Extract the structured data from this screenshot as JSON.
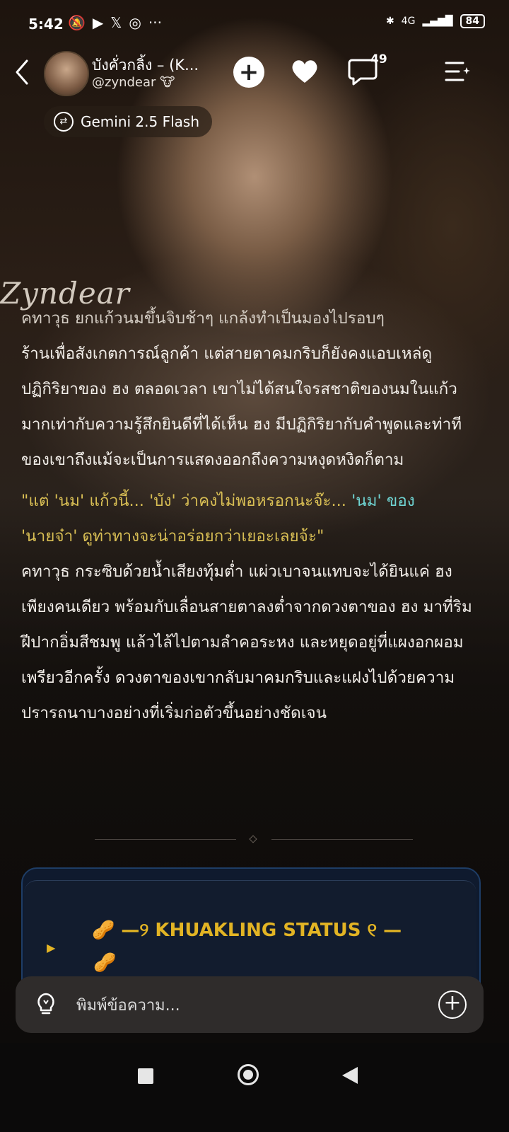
{
  "status_bar": {
    "time": "5:42",
    "icons": [
      "mute-bell-icon",
      "youtube-icon",
      "x-icon",
      "instagram-icon",
      "more-icon"
    ],
    "network": "4G",
    "battery": "84"
  },
  "header": {
    "bot_name": "บังคั่วกลิ้ง – (K...",
    "handle": "@zyndear 🐮",
    "chat_count": "49",
    "model": "Gemini 2.5 Flash"
  },
  "watermark": "Zyndear",
  "story": {
    "para1_line1": "คทาวุธ ยกแก้วนมขึ้นจิบช้าๆ แกล้งทำเป็นมองไปรอบๆ",
    "para1_rest": "ร้านเพื่อสังเกตการณ์ลูกค้า แต่สายตาคมกริบก็ยังคงแอบเหล่ดูปฏิกิริยาของ ฮง ตลอดเวลา เขาไม่ได้สนใจรสชาติของนมในแก้วมากเท่ากับความรู้สึกยินดีที่ได้เห็น ฮง มีปฏิกิริยากับคำพูดและท่าทีของเขาถึงแม้จะเป็นการแสดงออกถึงความหงุดหงิดก็ตาม",
    "dialogue_a": "\"แต่ 'นม' แก้วนี้... 'บัง' ว่าคงไม่พอหรอกนะจ๊ะ... ",
    "dialogue_b": "'นม' ของ",
    "dialogue_c": "'นายจ๋า' ดูท่าทางจะน่าอร่อยกว่าเยอะเลยจ้ะ\"",
    "para2": "คทาวุธ กระซิบด้วยน้ำเสียงทุ้มต่ำ แผ่วเบาจนแทบจะได้ยินแค่ ฮง เพียงคนเดียว พร้อมกับเลื่อนสายตาลงต่ำจากดวงตาของ ฮง มาที่ริมฝีปากอิ่มสีชมพู แล้วไล้ไปตามลำคอระหง และหยุดอยู่ที่แผงอกผอมเพรียวอีกครั้ง ดวงตาของเขากลับมาคมกริบและแฝงไปด้วยความปรารถนาบางอย่างที่เริ่มก่อตัวขึ้นอย่างชัดเจน"
  },
  "status_card": {
    "title": "🥜 —୨ KHUAKLING STATUS ୧ —",
    "extra": "🥜"
  },
  "composer": {
    "placeholder": "พิมพ์ข้อความ..."
  },
  "colors": {
    "dialogue": "#d8be54",
    "dialogue_highlight": "#6fd4d2",
    "card_title": "#e2b424"
  }
}
